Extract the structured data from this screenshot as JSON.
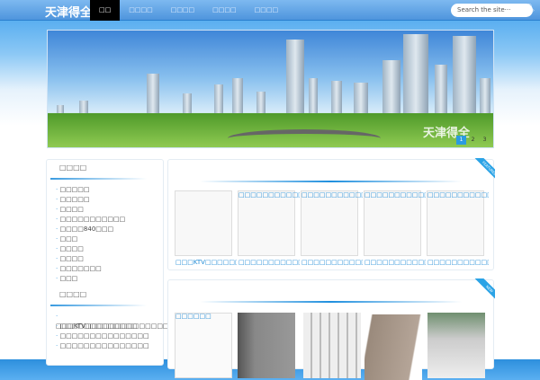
{
  "header": {
    "logo": "天津得全",
    "nav": [
      "□□",
      "□□□□",
      "□□□□",
      "□□□□",
      "□□□□"
    ],
    "search_placeholder": "Search the site···"
  },
  "banner": {
    "watermark": "天津得全",
    "pages": [
      "1",
      "2",
      "3"
    ],
    "active_page": 1
  },
  "sidebar": {
    "section1_title": "□□□□",
    "section1_items": [
      "□□□□□",
      "□□□□□",
      "□□□□",
      "□□□□□□□□□□□",
      "□□□□840□□□",
      "□□□",
      "□□□□",
      "□□□□",
      "□□□□□□□",
      "□□□"
    ],
    "section2_title": "□□□□",
    "section2_items": [
      "□□□KTV□□□□□□□□□□□□□□□□□□",
      "□□□□□□□□□□□□□",
      "□□□□□□□□□□□□□□□",
      "□□□□□□□□□□□□□□□"
    ]
  },
  "featured": {
    "ribbon": "FEATURED",
    "items": [
      {
        "top": "",
        "bottom": "□□□KTV□□□□□□□□□□"
      },
      {
        "top": "□□□□□□□□□□□□□",
        "bottom": "□□□□□□□□□□□□□"
      },
      {
        "top": "□□□□□□□□□□□□□□□",
        "bottom": "□□□□□□□□□□□□□□□"
      },
      {
        "top": "□□□□□□□□□□□□□□□",
        "bottom": "□□□□□□□□□□□□□□□"
      },
      {
        "top": "□□□□□□□□□□□□□□",
        "bottom": "□□□□□□□□□□□□□□"
      }
    ]
  },
  "new": {
    "ribbon": "NEW",
    "first_title": "□□□□□□"
  }
}
